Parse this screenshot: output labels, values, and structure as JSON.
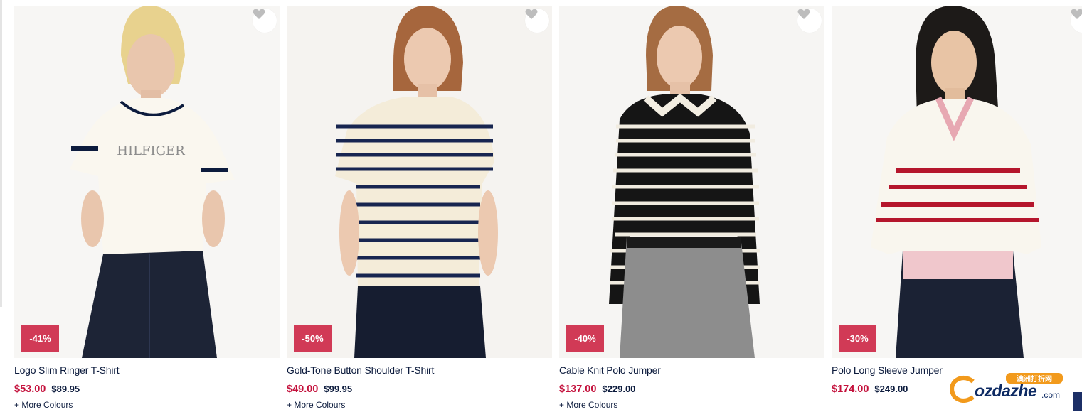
{
  "products": [
    {
      "name": "Logo Slim Ringer T-Shirt",
      "price": "$53.00",
      "was": "$89.95",
      "discount": "-41%",
      "more": "+ More Colours"
    },
    {
      "name": "Gold-Tone Button Shoulder T-Shirt",
      "price": "$49.00",
      "was": "$99.95",
      "discount": "-50%",
      "more": "+ More Colours"
    },
    {
      "name": "Cable Knit Polo Jumper",
      "price": "$137.00",
      "was": "$229.00",
      "discount": "-40%",
      "more": "+ More Colours"
    },
    {
      "name": "Polo Long Sleeve Jumper",
      "price": "$174.00",
      "was": "$249.00",
      "discount": "-30%",
      "more": ""
    }
  ],
  "watermark": {
    "logo_text": "ozdazhe",
    "domain": ".com",
    "cn": "澳洲打折网"
  },
  "colors": {
    "sale": "#c4113c",
    "badge": "#d13a56",
    "navy": "#0c1b3d"
  }
}
